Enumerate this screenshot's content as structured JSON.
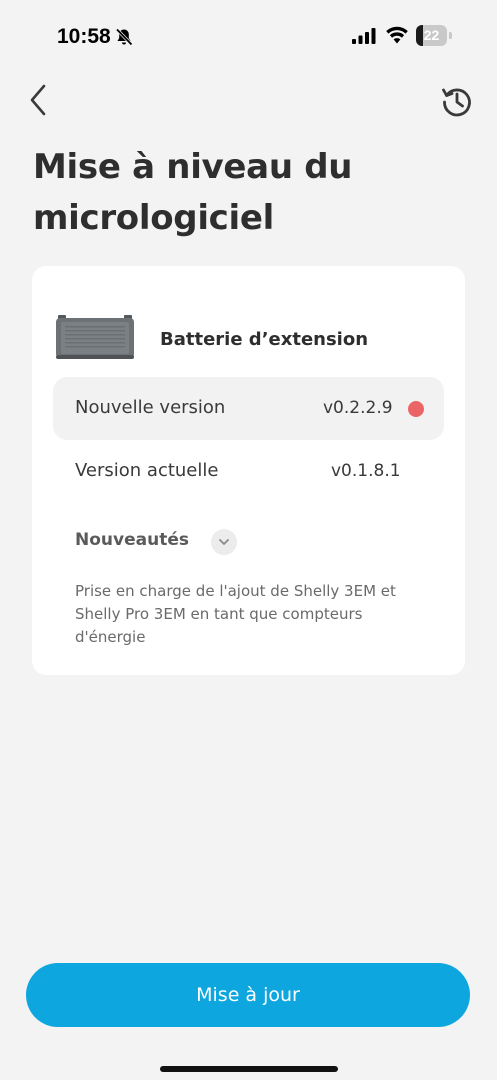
{
  "status_bar": {
    "time": "10:58",
    "battery_level": "22",
    "battery_fraction": 0.22,
    "icons": [
      "bell-slash-icon",
      "signal-icon",
      "wifi-icon",
      "battery-icon"
    ]
  },
  "nav": {
    "back_icon": "chevron-left-icon",
    "history_icon": "history-icon"
  },
  "page": {
    "title": "Mise à niveau du micrologiciel"
  },
  "device": {
    "name": "Batterie d’extension",
    "image_icon": "battery-device-image"
  },
  "versions": {
    "new_label": "Nouvelle version",
    "new_value": "v0.2.2.9",
    "current_label": "Version actuelle",
    "current_value": "v0.1.8.1"
  },
  "whats_new": {
    "label": "Nouveautés",
    "notes": "Prise en charge de l'ajout de Shelly 3EM et Shelly Pro 3EM en tant que compteurs d'énergie"
  },
  "actions": {
    "update_label": "Mise à jour"
  },
  "colors": {
    "accent": "#0ea6df",
    "badge": "#ec6566",
    "background": "#f3f3f3",
    "card": "#ffffff"
  }
}
